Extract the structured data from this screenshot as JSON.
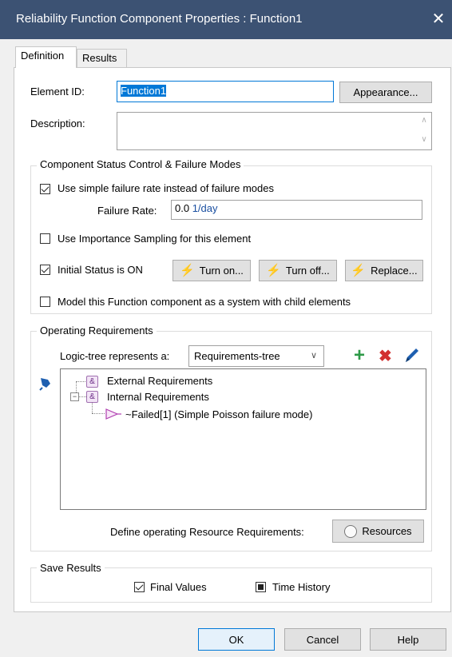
{
  "window": {
    "title": "Reliability Function Component Properties : Function1",
    "close_icon": "close-icon"
  },
  "tabs": [
    {
      "label": "Definition",
      "active": true
    },
    {
      "label": "Results",
      "active": false
    }
  ],
  "element": {
    "id_label": "Element ID:",
    "id_value": "Function1",
    "appearance_button": "Appearance...",
    "description_label": "Description:",
    "description_value": ""
  },
  "status_group": {
    "title": "Component Status Control & Failure Modes",
    "use_simple_failure_rate": {
      "label": "Use simple failure rate instead of failure modes",
      "checked": true
    },
    "failure_rate_label": "Failure Rate:",
    "failure_rate_value": "0.0",
    "failure_rate_unit": "1/day",
    "importance_sampling": {
      "label": "Use Importance Sampling for this element",
      "checked": false
    },
    "initial_status": {
      "label": "Initial Status is ON",
      "checked": true
    },
    "turn_on_button": "Turn on...",
    "turn_off_button": "Turn off...",
    "replace_button": "Replace...",
    "model_as_system": {
      "label": "Model this Function component as a system with child elements",
      "checked": false
    }
  },
  "operating_group": {
    "title": "Operating Requirements",
    "logic_tree_label": "Logic-tree represents a:",
    "logic_tree_selected": "Requirements-tree",
    "add_icon": "plus-icon",
    "delete_icon": "x-icon",
    "edit_icon": "pencil-icon",
    "pin_icon": "pin-icon",
    "tree": [
      {
        "label": "External Requirements",
        "icon": "and-gate-icon"
      },
      {
        "label": "Internal Requirements",
        "icon": "and-gate-icon"
      },
      {
        "label": "~Failed[1]  (Simple Poisson failure mode)",
        "icon": "failure-mode-icon"
      }
    ],
    "resource_label": "Define operating Resource Requirements:",
    "resources_button": "Resources"
  },
  "save_group": {
    "title": "Save Results",
    "final_values": {
      "label": "Final Values",
      "checked": true
    },
    "time_history": {
      "label": "Time History",
      "state": "indeterminate"
    }
  },
  "footer": {
    "ok": "OK",
    "cancel": "Cancel",
    "help": "Help"
  },
  "colors": {
    "titlebar": "#3c5273",
    "plus": "#2e9a48",
    "delete": "#d23030",
    "pencil": "#1e5fb0",
    "lightning": "#f0a81e"
  }
}
